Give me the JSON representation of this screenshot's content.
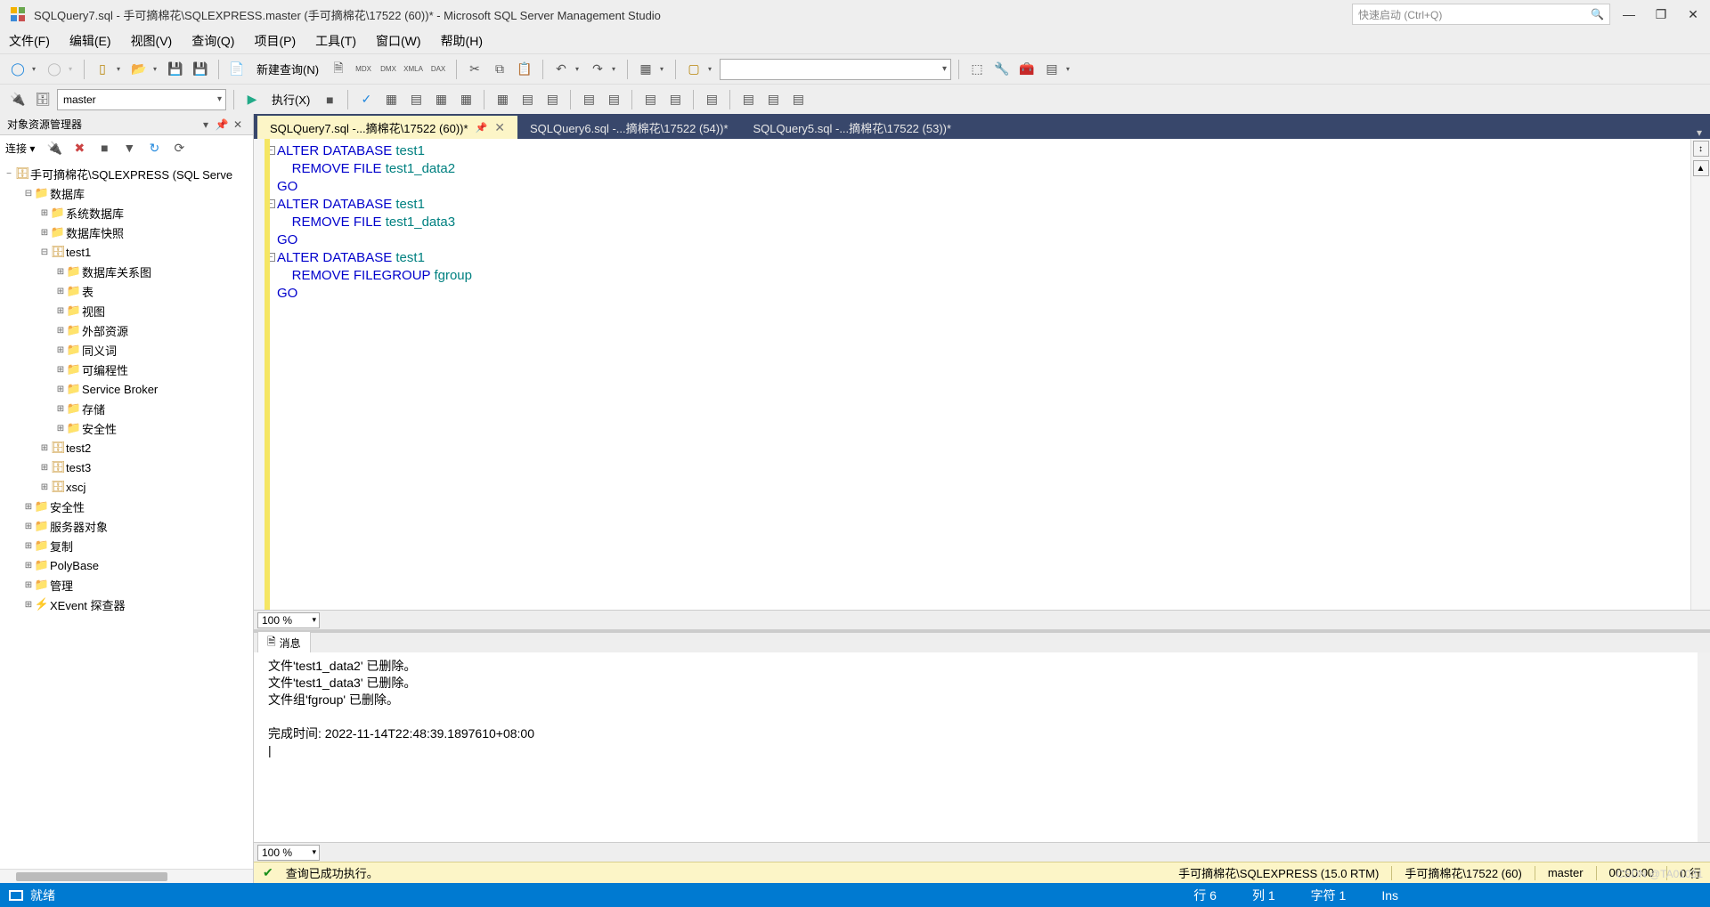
{
  "title": "SQLQuery7.sql - 手可摘棉花\\SQLEXPRESS.master (手可摘棉花\\17522 (60))* - Microsoft SQL Server Management Studio",
  "quick_launch_placeholder": "快速启动 (Ctrl+Q)",
  "menus": [
    "文件(F)",
    "编辑(E)",
    "视图(V)",
    "查询(Q)",
    "项目(P)",
    "工具(T)",
    "窗口(W)",
    "帮助(H)"
  ],
  "toolbar1": {
    "new_query": "新建查询(N)"
  },
  "toolbar2": {
    "db_combo": "master",
    "execute": "执行(X)"
  },
  "explorer": {
    "title": "对象资源管理器",
    "connect_label": "连接 ▾",
    "server": "手可摘棉花\\SQLEXPRESS (SQL Serve",
    "nodes": [
      {
        "l": 1,
        "t": "-",
        "i": "folder",
        "txt": "数据库"
      },
      {
        "l": 2,
        "t": "+",
        "i": "folder",
        "txt": "系统数据库"
      },
      {
        "l": 2,
        "t": "+",
        "i": "folder",
        "txt": "数据库快照"
      },
      {
        "l": 2,
        "t": "-",
        "i": "db",
        "txt": "test1"
      },
      {
        "l": 3,
        "t": "+",
        "i": "folder",
        "txt": "数据库关系图"
      },
      {
        "l": 3,
        "t": "+",
        "i": "folder",
        "txt": "表"
      },
      {
        "l": 3,
        "t": "+",
        "i": "folder",
        "txt": "视图"
      },
      {
        "l": 3,
        "t": "+",
        "i": "folder",
        "txt": "外部资源"
      },
      {
        "l": 3,
        "t": "+",
        "i": "folder",
        "txt": "同义词"
      },
      {
        "l": 3,
        "t": "+",
        "i": "folder",
        "txt": "可编程性"
      },
      {
        "l": 3,
        "t": "+",
        "i": "folder",
        "txt": "Service Broker"
      },
      {
        "l": 3,
        "t": "+",
        "i": "folder",
        "txt": "存储"
      },
      {
        "l": 3,
        "t": "+",
        "i": "folder",
        "txt": "安全性"
      },
      {
        "l": 2,
        "t": "+",
        "i": "db",
        "txt": "test2"
      },
      {
        "l": 2,
        "t": "+",
        "i": "db",
        "txt": "test3"
      },
      {
        "l": 2,
        "t": "+",
        "i": "db",
        "txt": "xscj"
      },
      {
        "l": 1,
        "t": "+",
        "i": "folder",
        "txt": "安全性"
      },
      {
        "l": 1,
        "t": "+",
        "i": "folder",
        "txt": "服务器对象"
      },
      {
        "l": 1,
        "t": "+",
        "i": "folder",
        "txt": "复制"
      },
      {
        "l": 1,
        "t": "+",
        "i": "folder",
        "txt": "PolyBase"
      },
      {
        "l": 1,
        "t": "+",
        "i": "folder",
        "txt": "管理"
      },
      {
        "l": 1,
        "t": "+",
        "i": "xe",
        "txt": "XEvent 探查器"
      }
    ]
  },
  "tabs": [
    {
      "label": "SQLQuery7.sql -...摘棉花\\17522 (60))*",
      "active": true
    },
    {
      "label": "SQLQuery6.sql -...摘棉花\\17522 (54))*",
      "active": false
    },
    {
      "label": "SQLQuery5.sql -...摘棉花\\17522 (53))*",
      "active": false
    }
  ],
  "code_lines": [
    {
      "fold": true,
      "tokens": [
        {
          "t": "kw",
          "v": "ALTER"
        },
        {
          "t": "p",
          "v": " "
        },
        {
          "t": "kw",
          "v": "DATABASE"
        },
        {
          "t": "p",
          "v": " "
        },
        {
          "t": "ident",
          "v": "test1"
        }
      ]
    },
    {
      "tokens": [
        {
          "t": "p",
          "v": "    "
        },
        {
          "t": "kw",
          "v": "REMOVE"
        },
        {
          "t": "p",
          "v": " "
        },
        {
          "t": "kw",
          "v": "FILE"
        },
        {
          "t": "p",
          "v": " "
        },
        {
          "t": "ident",
          "v": "test1_data2"
        }
      ]
    },
    {
      "tokens": [
        {
          "t": "go",
          "v": "GO"
        }
      ]
    },
    {
      "fold": true,
      "tokens": [
        {
          "t": "kw",
          "v": "ALTER"
        },
        {
          "t": "p",
          "v": " "
        },
        {
          "t": "kw",
          "v": "DATABASE"
        },
        {
          "t": "p",
          "v": " "
        },
        {
          "t": "ident",
          "v": "test1"
        }
      ]
    },
    {
      "tokens": [
        {
          "t": "p",
          "v": "    "
        },
        {
          "t": "kw",
          "v": "REMOVE"
        },
        {
          "t": "p",
          "v": " "
        },
        {
          "t": "kw",
          "v": "FILE"
        },
        {
          "t": "p",
          "v": " "
        },
        {
          "t": "ident",
          "v": "test1_data3"
        }
      ]
    },
    {
      "tokens": [
        {
          "t": "go",
          "v": "GO"
        }
      ]
    },
    {
      "fold": true,
      "tokens": [
        {
          "t": "kw",
          "v": "ALTER"
        },
        {
          "t": "p",
          "v": " "
        },
        {
          "t": "kw",
          "v": "DATABASE"
        },
        {
          "t": "p",
          "v": " "
        },
        {
          "t": "ident",
          "v": "test1"
        }
      ]
    },
    {
      "tokens": [
        {
          "t": "p",
          "v": "    "
        },
        {
          "t": "kw",
          "v": "REMOVE"
        },
        {
          "t": "p",
          "v": " "
        },
        {
          "t": "kw",
          "v": "FILEGROUP"
        },
        {
          "t": "p",
          "v": " "
        },
        {
          "t": "ident",
          "v": "fgroup"
        }
      ]
    },
    {
      "tokens": [
        {
          "t": "go",
          "v": "GO"
        }
      ]
    }
  ],
  "zoom": "100 %",
  "messages_tab": "消息",
  "messages": [
    "文件'test1_data2' 已删除。",
    "文件'test1_data3' 已删除。",
    "文件组'fgroup' 已删除。",
    "",
    "完成时间: 2022-11-14T22:48:39.1897610+08:00"
  ],
  "query_status": {
    "ok": "查询已成功执行。",
    "server": "手可摘棉花\\SQLEXPRESS (15.0 RTM)",
    "user": "手可摘棉花\\17522 (60)",
    "db": "master",
    "elapsed": "00:00:00",
    "rows": "0 行"
  },
  "statusbar": {
    "ready": "就绪",
    "line": "行 6",
    "col": "列 1",
    "char": "字符 1",
    "ins": "Ins"
  },
  "watermark": "CSDN @TA01031"
}
